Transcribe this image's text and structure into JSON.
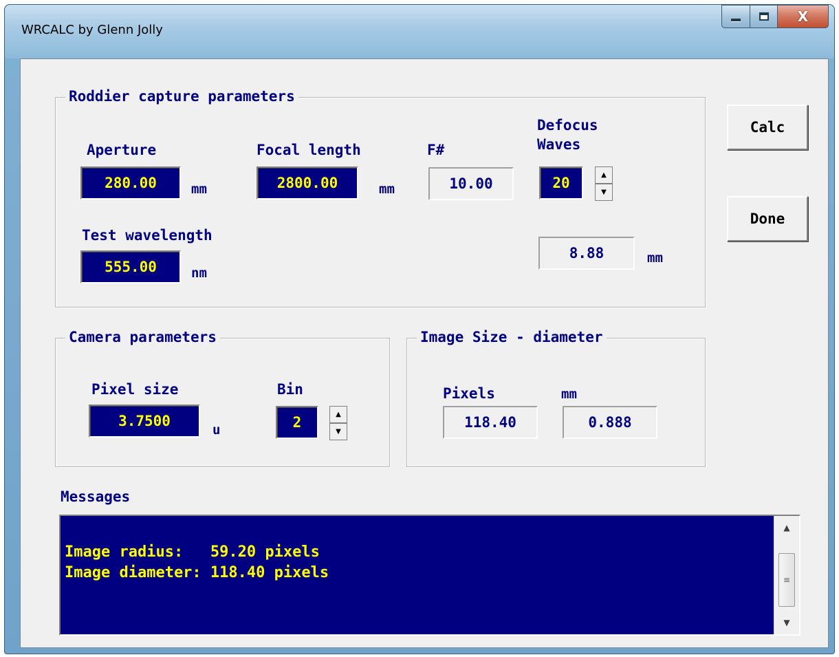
{
  "window": {
    "title": "WRCALC by Glenn Jolly",
    "close_glyph": "X",
    "minimize_icon": "minimize-icon",
    "maximize_icon": "maximize-icon"
  },
  "roddier": {
    "group_label": "Roddier capture parameters",
    "aperture_label": "Aperture",
    "aperture_value": "280.00",
    "aperture_unit": "mm",
    "focal_label": "Focal length",
    "focal_value": "2800.00",
    "focal_unit": "mm",
    "fnum_label": "F#",
    "fnum_value": "10.00",
    "defocus_label_1": "Defocus",
    "defocus_label_2": "Waves",
    "defocus_value": "20",
    "wavelength_label": "Test wavelength",
    "wavelength_value": "555.00",
    "wavelength_unit": "nm",
    "defocus_mm_value": "8.88",
    "defocus_mm_unit": "mm"
  },
  "camera": {
    "group_label": "Camera parameters",
    "pixel_label": "Pixel size",
    "pixel_value": "3.7500",
    "pixel_unit": "u",
    "bin_label": "Bin",
    "bin_value": "2"
  },
  "image_size": {
    "group_label": "Image Size - diameter",
    "pixels_label": "Pixels",
    "pixels_value": "118.40",
    "mm_label": "mm",
    "mm_value": "0.888"
  },
  "buttons": {
    "calc_label": "Calc",
    "done_label": "Done"
  },
  "messages": {
    "label": "Messages",
    "lines": [
      "Image radius:   59.20 pixels",
      "Image diameter: 118.40 pixels"
    ]
  },
  "colors": {
    "input_bg": "#000080",
    "input_text": "#ffff00",
    "label_text": "#000080"
  }
}
